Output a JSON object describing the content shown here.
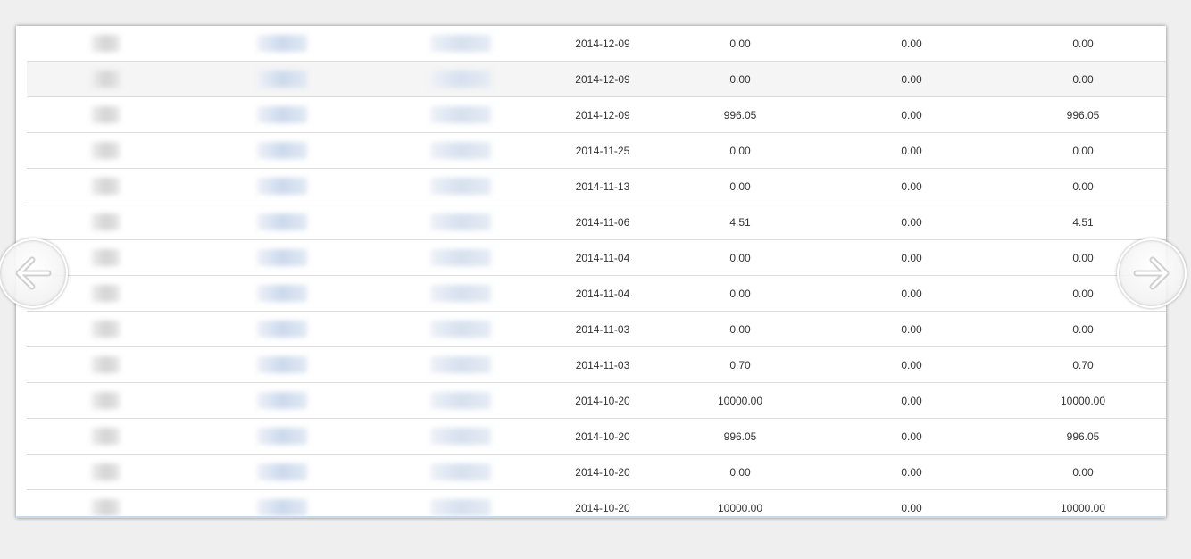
{
  "table": {
    "rows": [
      {
        "date": "2014-12-09",
        "income": "0.00",
        "expense": "0.00",
        "balance": "0.00"
      },
      {
        "date": "2014-12-09",
        "income": "0.00",
        "expense": "0.00",
        "balance": "0.00"
      },
      {
        "date": "2014-12-09",
        "income": "996.05",
        "expense": "0.00",
        "balance": "996.05"
      },
      {
        "date": "2014-11-25",
        "income": "0.00",
        "expense": "0.00",
        "balance": "0.00"
      },
      {
        "date": "2014-11-13",
        "income": "0.00",
        "expense": "0.00",
        "balance": "0.00"
      },
      {
        "date": "2014-11-06",
        "income": "4.51",
        "expense": "0.00",
        "balance": "4.51"
      },
      {
        "date": "2014-11-04",
        "income": "0.00",
        "expense": "0.00",
        "balance": "0.00"
      },
      {
        "date": "2014-11-04",
        "income": "0.00",
        "expense": "0.00",
        "balance": "0.00"
      },
      {
        "date": "2014-11-03",
        "income": "0.00",
        "expense": "0.00",
        "balance": "0.00"
      },
      {
        "date": "2014-11-03",
        "income": "0.70",
        "expense": "0.00",
        "balance": "0.70"
      },
      {
        "date": "2014-10-20",
        "income": "10000.00",
        "expense": "0.00",
        "balance": "10000.00"
      },
      {
        "date": "2014-10-20",
        "income": "996.05",
        "expense": "0.00",
        "balance": "996.05"
      },
      {
        "date": "2014-10-20",
        "income": "0.00",
        "expense": "0.00",
        "balance": "0.00"
      },
      {
        "date": "2014-10-20",
        "income": "10000.00",
        "expense": "0.00",
        "balance": "10000.00"
      }
    ],
    "highlighted_row": 1
  },
  "nav": {
    "prev_icon": "arrow-left-icon",
    "next_icon": "arrow-right-icon"
  },
  "colors": {
    "background": "#efefef",
    "row_border": "#dcdcdc",
    "highlight_row": "#f5f5f5",
    "text": "#333333"
  }
}
